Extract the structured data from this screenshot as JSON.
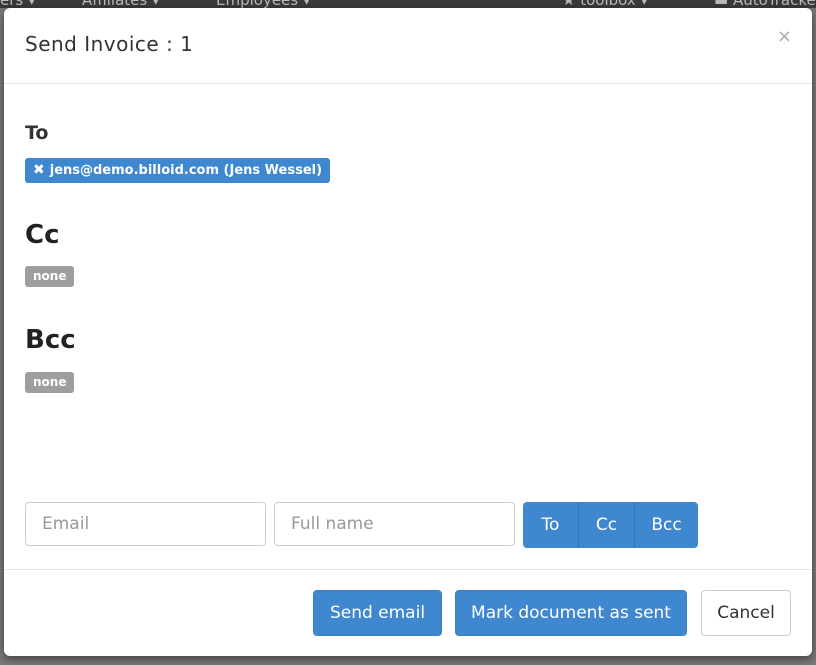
{
  "background": {
    "nav_items": [
      "ers ▾",
      "Affiliates ▾",
      "Employees ▾",
      "★ toolbox ▾",
      "▬ AutoTracke"
    ]
  },
  "modal": {
    "title": "Send Invoice : 1",
    "close_label": "×",
    "to_label": "To",
    "to_recipient": "jens@demo.billoid.com (Jens Wessel)",
    "remove_icon": "✖",
    "cc_label": "Cc",
    "cc_value": "none",
    "bcc_label": "Bcc",
    "bcc_value": "none",
    "email_placeholder": "Email",
    "fullname_placeholder": "Full name",
    "add_buttons": [
      "To",
      "Cc",
      "Bcc"
    ],
    "footer": {
      "send_label": "Send email",
      "mark_sent_label": "Mark document as sent",
      "cancel_label": "Cancel"
    }
  },
  "colors": {
    "primary": "#3f88d0",
    "badge": "#9e9e9e"
  }
}
